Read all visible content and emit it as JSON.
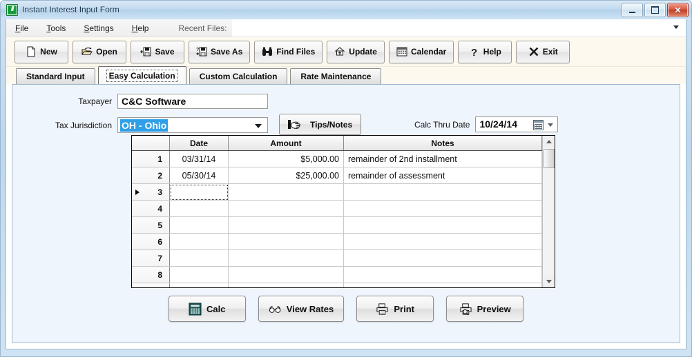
{
  "window": {
    "title": "Instant Interest Input Form",
    "app_icon": "instant-interest-icon",
    "icon_glyph": "II",
    "controls": {
      "minimize": "Minimize",
      "maximize": "Maximize",
      "close": "Close",
      "close_glyph": "✕"
    }
  },
  "menubar": {
    "items": [
      {
        "label": "File",
        "accel": "F"
      },
      {
        "label": "Tools",
        "accel": "T"
      },
      {
        "label": "Settings",
        "accel": "S"
      },
      {
        "label": "Help",
        "accel": "H"
      }
    ],
    "recent_files_label": "Recent Files:",
    "recent_files_value": "",
    "recent_files_placeholder": ""
  },
  "toolbar": {
    "buttons": [
      {
        "label": "New",
        "icon": "page-icon"
      },
      {
        "label": "Open",
        "icon": "open-folder-icon"
      },
      {
        "label": "Save",
        "icon": "floppy-disk-icon"
      },
      {
        "label": "Save As",
        "icon": "floppy-disk-question-icon"
      },
      {
        "label": "Find Files",
        "icon": "binoculars-icon"
      },
      {
        "label": "Update",
        "icon": "house-arrow-icon"
      },
      {
        "label": "Calendar",
        "icon": "calendar-icon"
      },
      {
        "label": "Help",
        "icon": "question-mark-icon"
      },
      {
        "label": "Exit",
        "icon": "x-icon"
      }
    ]
  },
  "tabs": [
    {
      "label": "Standard Input",
      "active": false
    },
    {
      "label": "Easy Calculation",
      "active": true
    },
    {
      "label": "Custom Calculation",
      "active": false
    },
    {
      "label": "Rate Maintenance",
      "active": false
    }
  ],
  "form": {
    "taxpayer_label": "Taxpayer",
    "taxpayer_value": "C&C Software",
    "jurisdiction_label": "Tax Jurisdiction",
    "jurisdiction_value": "OH  - Ohio",
    "tips_button": "Tips/Notes",
    "tips_icon": "pointing-hand-icon",
    "calc_thru_label": "Calc Thru Date",
    "calc_thru_value": "10/24/14",
    "calc_thru_icon": "calendar-picker-icon"
  },
  "grid": {
    "columns": [
      "",
      "Date",
      "Amount",
      "Notes"
    ],
    "rows": [
      {
        "num": "1",
        "date": "03/31/14",
        "amount": "$5,000.00",
        "notes": "remainder of 2nd installment",
        "current": false
      },
      {
        "num": "2",
        "date": "05/30/14",
        "amount": "$25,000.00",
        "notes": "remainder of assessment",
        "current": false
      },
      {
        "num": "3",
        "date": "",
        "amount": "",
        "notes": "",
        "current": true
      },
      {
        "num": "4",
        "date": "",
        "amount": "",
        "notes": "",
        "current": false
      },
      {
        "num": "5",
        "date": "",
        "amount": "",
        "notes": "",
        "current": false
      },
      {
        "num": "6",
        "date": "",
        "amount": "",
        "notes": "",
        "current": false
      },
      {
        "num": "7",
        "date": "",
        "amount": "",
        "notes": "",
        "current": false
      },
      {
        "num": "8",
        "date": "",
        "amount": "",
        "notes": "",
        "current": false
      }
    ],
    "scrollbar": {
      "up": "scroll-up",
      "down": "scroll-down"
    }
  },
  "actions": [
    {
      "label": "Calc",
      "icon": "calculator-icon"
    },
    {
      "label": "View Rates",
      "icon": "glasses-icon"
    },
    {
      "label": "Print",
      "icon": "printer-icon"
    },
    {
      "label": "Preview",
      "icon": "print-preview-icon"
    }
  ],
  "colors": {
    "accent": "#2f9fe8",
    "toolbar_bg": "#fdf9ef",
    "page_bg": "#eff5fd",
    "close_button": "#c23b24"
  }
}
